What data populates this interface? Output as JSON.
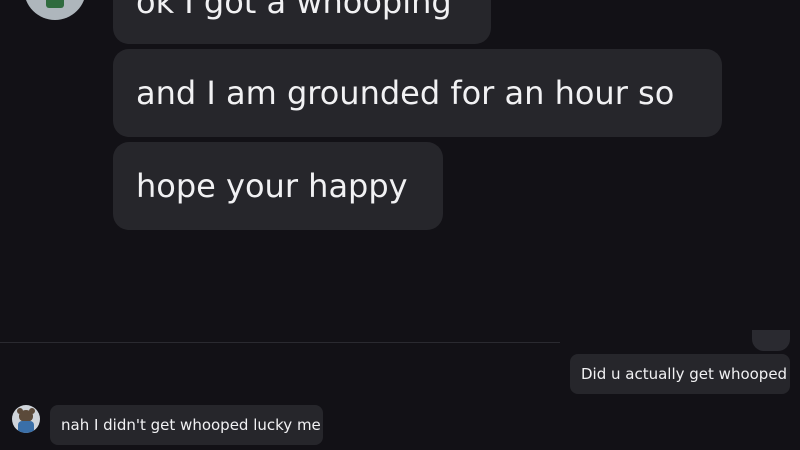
{
  "chat": {
    "top_messages": [
      {
        "text": "ok I got a whooping"
      },
      {
        "text": "and I am grounded for an hour so"
      },
      {
        "text": "hope your happy"
      }
    ],
    "bottom_messages": {
      "outgoing": "Did u actually get whooped",
      "incoming": "nah I didn't get whooped lucky me"
    }
  }
}
